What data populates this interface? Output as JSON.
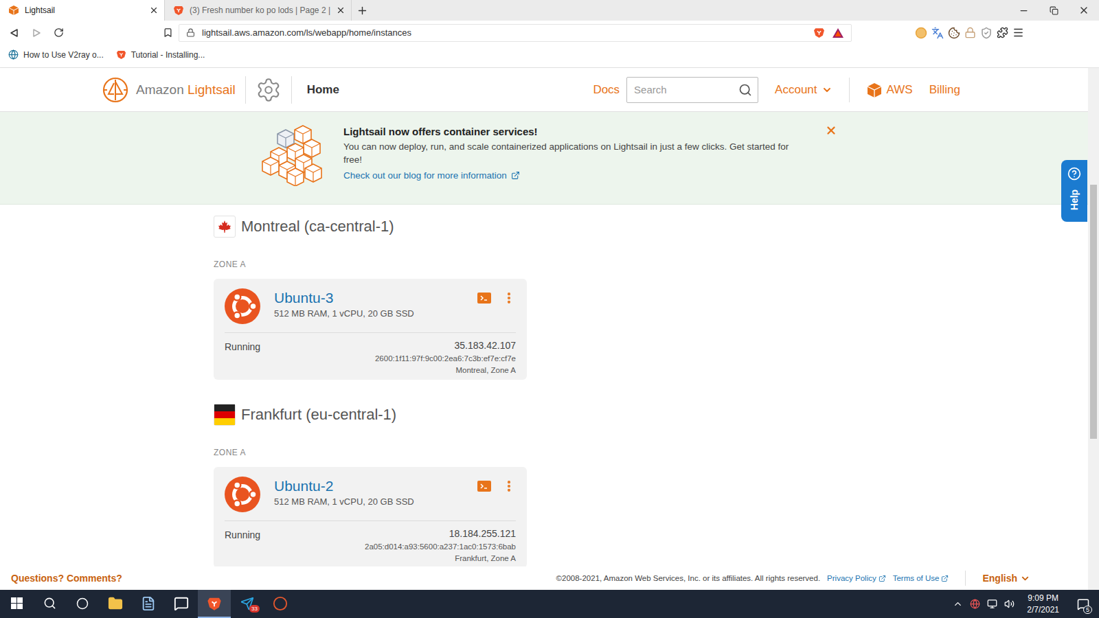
{
  "browser": {
    "tabs": [
      {
        "label": "Lightsail",
        "selected": true,
        "kind": "lightsail"
      },
      {
        "label": "(3) Fresh number ko po lods | Page 2 |",
        "selected": false,
        "kind": "forum"
      }
    ],
    "url": "lightsail.aws.amazon.com/ls/webapp/home/instances",
    "bookmarks": [
      {
        "label": "How to Use V2ray o...",
        "kind": "wordpress"
      },
      {
        "label": "Tutorial - Installing...",
        "kind": "shield"
      }
    ]
  },
  "header": {
    "brand_prefix": "Amazon",
    "brand_name": "Lightsail",
    "nav": [
      {
        "label": "Home",
        "selected": true
      }
    ],
    "docs": "Docs",
    "search_placeholder": "Search",
    "account": "Account",
    "aws": "AWS",
    "billing": "Billing"
  },
  "banner": {
    "title": "Lightsail now offers container services!",
    "text": "You can now deploy, run, and scale containerized applications on Lightsail in just a few clicks. Get started for free!",
    "link": "Check out our blog for more information"
  },
  "regions": [
    {
      "name": "Montreal (ca-central-1)",
      "kind": "canada",
      "zone": "ZONE A",
      "instances": [
        {
          "name": "Ubuntu-3",
          "specs": "512 MB RAM, 1 vCPU, 20 GB SSD",
          "status": "Running",
          "ipv4": "35.183.42.107",
          "ipv6": "2600:1f11:97f:9c00:2ea6:7c3b:ef7e:cf7e",
          "location": "Montreal, Zone A"
        }
      ]
    },
    {
      "name": "Frankfurt (eu-central-1)",
      "kind": "germany",
      "zone": "ZONE A",
      "instances": [
        {
          "name": "Ubuntu-2",
          "specs": "512 MB RAM, 1 vCPU, 20 GB SSD",
          "status": "Running",
          "ipv4": "18.184.255.121",
          "ipv6": "2a05:d014:a93:5600:a237:1ac0:1573:6bab",
          "location": "Frankfurt, Zone A"
        }
      ]
    }
  ],
  "help": {
    "label": "Help"
  },
  "footer": {
    "feedback": "Questions? Comments?",
    "copyright": "©2008-2021, Amazon Web Services, Inc. or its affiliates. All rights reserved.",
    "links": [
      "Privacy Policy",
      "Terms of Use"
    ],
    "language": "English"
  },
  "taskbar": {
    "apps": [
      {
        "kind": "explorer",
        "selected": false
      },
      {
        "kind": "notepad",
        "selected": false
      },
      {
        "kind": "skype",
        "selected": false
      },
      {
        "kind": "brave",
        "selected": true
      },
      {
        "kind": "telegram",
        "selected": false,
        "badge": "33"
      },
      {
        "kind": "chrome",
        "selected": false
      }
    ],
    "time": "9:09 PM",
    "date": "2/7/2021",
    "notifications": "5"
  }
}
